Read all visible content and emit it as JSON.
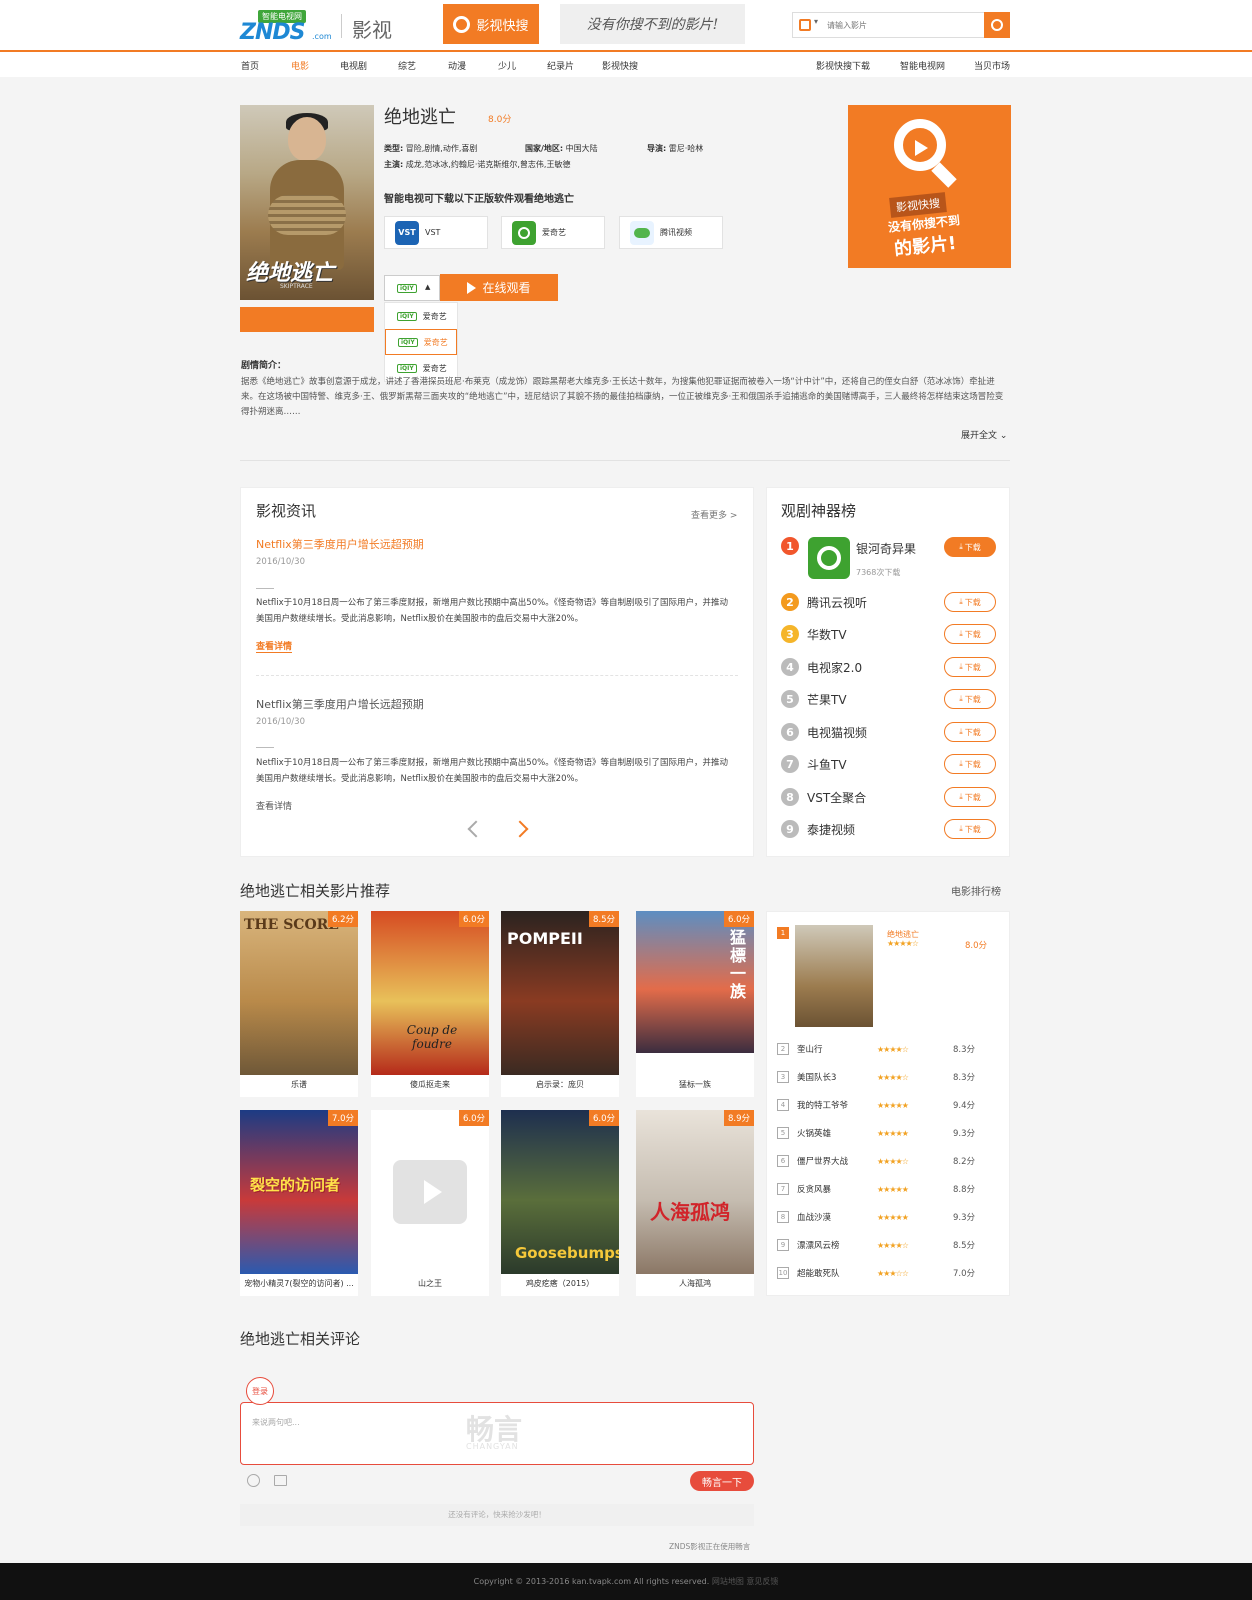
{
  "header": {
    "logo_badge": "智能电视网",
    "logo_text": "ZNDS",
    "logo_com": ".com",
    "site_name": "影视",
    "quick_search": "影视快搜",
    "slogan": "没有你搜不到的影片!",
    "search_placeholder": "请输入影片",
    "nav": [
      "首页",
      "电影",
      "电视剧",
      "综艺",
      "动漫",
      "少儿",
      "纪录片",
      "影视快搜"
    ],
    "nav_right": [
      "影视快搜下载",
      "智能电视网",
      "当贝市场"
    ]
  },
  "movie": {
    "title": "绝地逃亡",
    "score": "8.0分",
    "poster_title": "绝地逃亡",
    "poster_sub": "SKIPTRACE",
    "type_label": "类型:",
    "type": "冒险,剧情,动作,喜剧",
    "region_label": "国家/地区:",
    "region": "中国大陆",
    "director_label": "导演:",
    "director": "雷尼·哈林",
    "cast_label": "主演:",
    "cast": "成龙,范冰冰,约翰尼·诺克斯维尔,曾志伟,王敏德",
    "download_title": "智能电视可下载以下正版软件观看绝地逃亡",
    "apps": [
      "VST",
      "爱奇艺",
      "腾讯视频"
    ],
    "source_badge": "iQIY",
    "watch_online": "在线观看",
    "sources": [
      "爱奇艺",
      "爱奇艺",
      "爱奇艺"
    ],
    "plot_label": "剧情简介：",
    "plot": "据悉《绝地逃亡》故事创意源于成龙，讲述了香港探员班尼·布莱克（成龙饰）跟踪黑帮老大维克多·王长达十数年，为搜集他犯罪证据而被卷入一场“计中计”中，还将自己的侄女白舒（范冰冰饰）牵扯进来。在这场被中国特警、维克多·王、俄罗斯黑帮三面夹攻的“绝地逃亡”中，班尼结识了其貌不扬的最佳拍档康纳，一位正被维克多·王和俄国杀手追捕逃命的美国赌博高手，三人最终将怎样结束这场冒险变得扑朔迷离……",
    "expand": "展开全文"
  },
  "ad": {
    "line1": "影视快搜",
    "line2": "没有你搜不到",
    "line3": "的影片!"
  },
  "news": {
    "title": "影视资讯",
    "more": "查看更多 >",
    "items": [
      {
        "title": "Netflix第三季度用户增长远超预期",
        "date": "2016/10/30",
        "text": "Netflix于10月18日周一公布了第三季度财报，新增用户数比预期中高出50%。《怪奇物语》等自制剧吸引了国际用户，并推动美国用户数继续增长。受此消息影响，Netflix股价在美国股市的盘后交易中大涨20%。",
        "link": "查看详情"
      },
      {
        "title": "Netflix第三季度用户增长远超预期",
        "date": "2016/10/30",
        "text": "Netflix于10月18日周一公布了第三季度财报，新增用户数比预期中高出50%。《怪奇物语》等自制剧吸引了国际用户，并推动美国用户数继续增长。受此消息影响，Netflix股价在美国股市的盘后交易中大涨20%。",
        "link": "查看详情"
      }
    ]
  },
  "app_rank": {
    "title": "观剧神器榜",
    "download": "下载",
    "top_downloads": "7368次下载",
    "items": [
      {
        "rank": "1",
        "name": "银河奇异果",
        "color": "#f1562c"
      },
      {
        "rank": "2",
        "name": "腾讯云视听",
        "color": "#f39a1e"
      },
      {
        "rank": "3",
        "name": "华数TV",
        "color": "#f5b52a"
      },
      {
        "rank": "4",
        "name": "电视家2.0",
        "color": "#bbbbbb"
      },
      {
        "rank": "5",
        "name": "芒果TV",
        "color": "#bbbbbb"
      },
      {
        "rank": "6",
        "name": "电视猫视频",
        "color": "#bbbbbb"
      },
      {
        "rank": "7",
        "name": "斗鱼TV",
        "color": "#bbbbbb"
      },
      {
        "rank": "8",
        "name": "VST全聚合",
        "color": "#bbbbbb"
      },
      {
        "rank": "9",
        "name": "泰捷视频",
        "color": "#bbbbbb"
      }
    ]
  },
  "related": {
    "title": "绝地逃亡相关影片推荐",
    "more": "电影排行榜",
    "films": [
      {
        "name": "乐谱",
        "score": "6.2分",
        "poster": "THE SCORE",
        "bg": "linear-gradient(180deg,#d9b57d,#b98a4a 55%,#6f5838)"
      },
      {
        "name": "傻瓜抠走来",
        "score": "6.0分",
        "poster": "Coup de foudre",
        "bg": "linear-gradient(180deg,#d64b22,#e8c15a 55%,#b52a1a)"
      },
      {
        "name": "启示录：庞贝",
        "score": "8.5分",
        "poster": "POMPEII",
        "bg": "linear-gradient(180deg,#2b2320,#8a3b22 55%,#3a2a22)"
      },
      {
        "name": "猛标一族",
        "score": "6.0分",
        "poster": "猛標一族",
        "bg": "linear-gradient(180deg,#5d8ec2,#e36c4a 55%,#3b2d3f)"
      },
      {
        "name": "宠物小精灵7(裂空的访问者) ...",
        "score": "7.0分",
        "poster": "裂空的访问者",
        "bg": "linear-gradient(180deg,#1c3b84,#c83a3a 55%,#2a5ab0)"
      },
      {
        "name": "山之王",
        "score": "6.0分",
        "poster": "",
        "bg": "#ffffff"
      },
      {
        "name": "鸡皮疙瘩（2015）",
        "score": "6.0分",
        "poster": "Goosebumps",
        "bg": "linear-gradient(180deg,#1e2f4f,#5a6e3b 55%,#2b3a2b)"
      },
      {
        "name": "人海孤鸿",
        "score": "8.9分",
        "poster": "人海孤鸿",
        "bg": "linear-gradient(180deg,#e9e3da,#c5bcb0 55%,#8b7766)"
      }
    ]
  },
  "top10": {
    "first": {
      "rank": "1",
      "name": "绝地逃亡",
      "stars": "★★★★☆",
      "score": "8.0分"
    },
    "items": [
      {
        "rank": "2",
        "name": "奎山行",
        "stars": "★★★★☆",
        "score": "8.3分"
      },
      {
        "rank": "3",
        "name": "美国队长3",
        "stars": "★★★★☆",
        "score": "8.3分"
      },
      {
        "rank": "4",
        "name": "我的特工爷爷",
        "stars": "★★★★★",
        "score": "9.4分"
      },
      {
        "rank": "5",
        "name": "火锅英雄",
        "stars": "★★★★★",
        "score": "9.3分"
      },
      {
        "rank": "6",
        "name": "僵尸世界大战",
        "stars": "★★★★☆",
        "score": "8.2分"
      },
      {
        "rank": "7",
        "name": "反贪风暴",
        "stars": "★★★★★",
        "score": "8.8分"
      },
      {
        "rank": "8",
        "name": "血战沙漠",
        "stars": "★★★★★",
        "score": "9.3分"
      },
      {
        "rank": "9",
        "name": "漂漂风云榜",
        "stars": "★★★★☆",
        "score": "8.5分"
      },
      {
        "rank": "10",
        "name": "超能敢死队",
        "stars": "★★★☆☆",
        "score": "7.0分"
      }
    ]
  },
  "comments": {
    "title": "绝地逃亡相关评论",
    "login": "登录",
    "placeholder": "来说两句吧...",
    "watermark": "畅言",
    "watermark_sub": "CHANGYAN",
    "submit": "畅言一下",
    "empty": "还没有评论，快来抢沙发吧！",
    "using": "ZNDS影视正在使用畅言"
  },
  "footer": {
    "copyright": "Copyright © 2013-2016 kan.tvapk.com All rights reserved.",
    "links": "网站地图  意见反馈"
  },
  "colors": {
    "accent": "#f27b24",
    "red": "#e74c3c",
    "green": "#3ea230"
  }
}
